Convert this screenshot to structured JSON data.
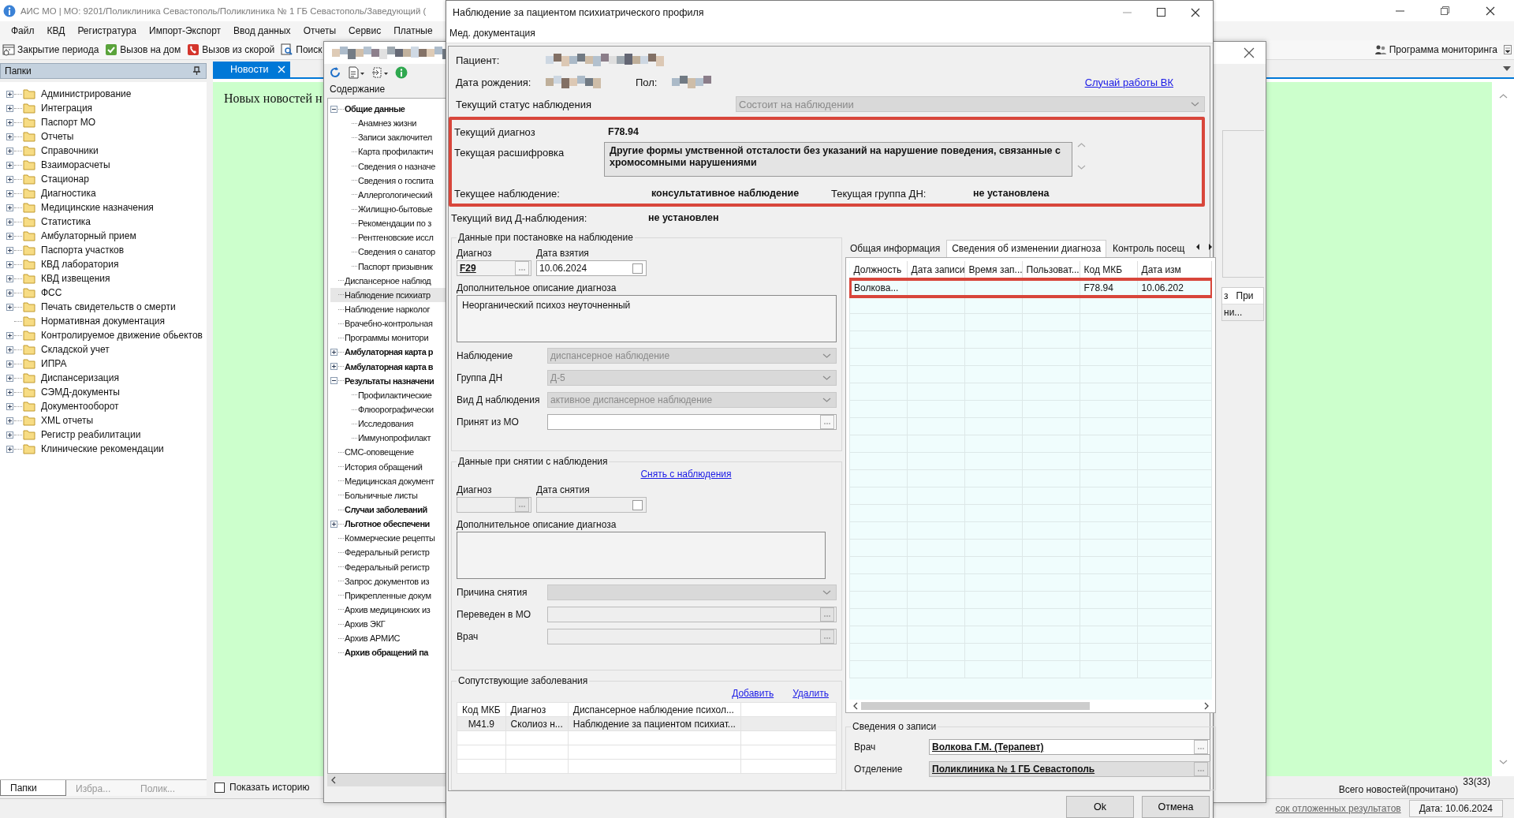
{
  "app": {
    "title": "АИС МО | МО: 9201/Поликлиника Севастополь/Поликлиника № 1 ГБ Севастополь/Заведующий (",
    "menu": [
      "Файл",
      "КВД",
      "Регистратура",
      "Импорт-Экспорт",
      "Ввод данных",
      "Отчеты",
      "Сервис",
      "Платные"
    ],
    "toolbar": [
      {
        "label": "Закрытие периода",
        "kind": "calendar"
      },
      {
        "label": "Вызов на дом",
        "kind": "check"
      },
      {
        "label": "Вызов из скорой",
        "kind": "phone"
      },
      {
        "label": "Поиск",
        "kind": "search"
      }
    ],
    "toolbar_right": [
      {
        "label": "Программа мониторинга",
        "kind": "people"
      }
    ],
    "folders": {
      "title": "Папки",
      "items": [
        {
          "label": "Администрирование",
          "has_children": true
        },
        {
          "label": "Интеграция",
          "has_children": true
        },
        {
          "label": "Паспорт МО",
          "has_children": true
        },
        {
          "label": "Отчеты",
          "has_children": true
        },
        {
          "label": "Справочники",
          "has_children": true
        },
        {
          "label": "Взаиморасчеты",
          "has_children": true
        },
        {
          "label": "Стационар",
          "has_children": true
        },
        {
          "label": "Диагностика",
          "has_children": true
        },
        {
          "label": "Медицинские назначения",
          "has_children": true
        },
        {
          "label": "Статистика",
          "has_children": true
        },
        {
          "label": "Амбулаторный прием",
          "has_children": true
        },
        {
          "label": "Паспорта участков",
          "has_children": true
        },
        {
          "label": "КВД лаборатория",
          "has_children": true
        },
        {
          "label": "КВД извещения",
          "has_children": true
        },
        {
          "label": "ФСС",
          "has_children": true
        },
        {
          "label": "Печать свидетельств о смерти",
          "has_children": true
        },
        {
          "label": "Нормативная документация",
          "has_children": false
        },
        {
          "label": "Контролируемое движение обьектов",
          "has_children": true
        },
        {
          "label": "Складской учет",
          "has_children": true
        },
        {
          "label": "ИПРА",
          "has_children": true
        },
        {
          "label": "Диспансеризация",
          "has_children": true
        },
        {
          "label": "СЭМД-документы",
          "has_children": true
        },
        {
          "label": "Документооборот",
          "has_children": true
        },
        {
          "label": "XML отчеты",
          "has_children": true
        },
        {
          "label": "Регистр реабилитации",
          "has_children": true
        },
        {
          "label": "Клинические рекомендации",
          "has_children": true
        }
      ],
      "tabs": [
        {
          "label": "Папки",
          "selected": true
        },
        {
          "label": "Избра...",
          "selected": false
        },
        {
          "label": "Полик...",
          "selected": false
        }
      ]
    },
    "news": {
      "tab": "Новости",
      "message": "Новых новостей н",
      "show_history": {
        "label": "Показать историю",
        "checked": false
      },
      "total_label": "Всего новостей(прочитано)",
      "total": "33(33)"
    },
    "status_bar": {
      "link": "сок отложенных результатов",
      "date": "Дата: 10.06.2024"
    }
  },
  "card_window": {
    "contents_title": "Содержание",
    "tree": [
      {
        "label": "Общие данные",
        "bold": true,
        "selected": false,
        "expanded": true,
        "children": [
          {
            "label": "Анамнез жизни",
            "selected": false
          },
          {
            "label": "Записи заключител",
            "selected": false
          },
          {
            "label": "Карта профилактич",
            "selected": false
          },
          {
            "label": "Сведения о назначе",
            "selected": false
          },
          {
            "label": "Сведения о госпита",
            "selected": false
          },
          {
            "label": "Аллергологический",
            "selected": false
          },
          {
            "label": "Жилищно-бытовые",
            "selected": false
          },
          {
            "label": "Рекомендации по з",
            "selected": false
          },
          {
            "label": "Рентгеновские иссл",
            "selected": false
          },
          {
            "label": "Сведения о санатор",
            "selected": false
          },
          {
            "label": "Паспорт призывник",
            "selected": false
          }
        ]
      },
      {
        "label": "Диспансерное наблюд",
        "bold": false,
        "selected": false
      },
      {
        "label": "Наблюдение психиатр",
        "bold": false,
        "selected": true
      },
      {
        "label": "Наблюдение нарколог",
        "bold": false,
        "selected": false
      },
      {
        "label": "Врачебно-контрольная",
        "bold": false,
        "selected": false
      },
      {
        "label": "Программы монитори",
        "bold": false,
        "selected": false
      },
      {
        "label": "Амбулаторная карта р",
        "bold": true,
        "selected": false,
        "expanded": false
      },
      {
        "label": "Амбулаторная карта в",
        "bold": true,
        "selected": false,
        "expanded": false
      },
      {
        "label": "Результаты назначени",
        "bold": true,
        "selected": false,
        "expanded": true,
        "children": [
          {
            "label": "Профилактические",
            "selected": false
          },
          {
            "label": "Флюорографически",
            "selected": false
          },
          {
            "label": "Исследования",
            "selected": false
          },
          {
            "label": "Иммунопрофилакт",
            "selected": false
          }
        ]
      },
      {
        "label": "СМС-оповещение",
        "bold": false,
        "selected": false
      },
      {
        "label": "История обращений",
        "bold": false,
        "selected": false
      },
      {
        "label": "Медицинская документ",
        "bold": false,
        "selected": false
      },
      {
        "label": "Больничные листы",
        "bold": false,
        "selected": false
      },
      {
        "label": "Случаи заболеваний",
        "bold": true,
        "selected": false
      },
      {
        "label": "Льготное обеспечени",
        "bold": true,
        "selected": false,
        "expanded": false
      },
      {
        "label": "Коммерческие рецепты",
        "bold": false,
        "selected": false
      },
      {
        "label": "Федеральный регистр",
        "bold": false,
        "selected": false
      },
      {
        "label": "Федеральный регистр",
        "bold": false,
        "selected": false
      },
      {
        "label": "Запрос документов из",
        "bold": false,
        "selected": false
      },
      {
        "label": "Прикрепленные докум",
        "bold": false,
        "selected": false
      },
      {
        "label": "Архив медицинских из",
        "bold": false,
        "selected": false
      },
      {
        "label": "Архив ЭКГ",
        "bold": false,
        "selected": false
      },
      {
        "label": "Архив АРМИС",
        "bold": false,
        "selected": false
      },
      {
        "label": "Архив обращений па",
        "bold": true,
        "selected": false
      }
    ],
    "grid_columns": [
      "з",
      "При"
    ],
    "grid_cells": [
      "ни..."
    ]
  },
  "dialog": {
    "title": "Наблюдение за пациентом психиатрического профиля",
    "menu": [
      "Мед. документация"
    ],
    "patient": {
      "patient_label": "Пациент:",
      "birth_label": "Дата рождения:",
      "sex_label": "Пол:",
      "vk_link": "Случай работы ВК",
      "status_label": "Текущий статус наблюдения",
      "status": {
        "value": "Состоит на наблюдении",
        "disabled": true
      }
    },
    "current": {
      "highlight": true,
      "diagnosis_label": "Текущий диагноз",
      "diagnosis": "F78.94",
      "decoding_label": "Текущая расшифровка",
      "decoding": "Другие формы умственной отсталости без указаний на нарушение поведения, связанные с хромосомными нарушениями",
      "observation_label": "Текущее наблюдение:",
      "observation": "консультативное наблюдение",
      "group_label": "Текущая группа ДН:",
      "group": "не установлена"
    },
    "d_type_label": "Текущий вид Д-наблюдения:",
    "d_type": "не установлен",
    "registration": {
      "title": "Данные при постановке на наблюдение",
      "diagnosis_label": "Диагноз",
      "diagnosis": "F29",
      "date_label": "Дата взятия",
      "date": "10.06.2024",
      "description_label": "Дополнительное описание диагноза",
      "description": "Неорганический психоз неуточненный",
      "fields": [
        {
          "label": "Наблюдение",
          "value": "диспансерное наблюдение",
          "kind": "dropdown",
          "disabled": true
        },
        {
          "label": "Группа ДН",
          "value": "Д-5",
          "kind": "dropdown",
          "disabled": true
        },
        {
          "label": "Вид Д наблюдения",
          "value": "активное диспансерное наблюдение",
          "kind": "dropdown",
          "disabled": true
        },
        {
          "label": "Принят из МО",
          "kind": "lookup",
          "disabled": false
        }
      ]
    },
    "removal": {
      "title": "Данные при снятии с наблюдения",
      "link": "Снять с наблюдения",
      "diagnosis_label": "Диагноз",
      "date_label": "Дата снятия",
      "description_label": "Дополнительное описание диагноза",
      "fields": [
        {
          "label": "Причина снятия",
          "kind": "dropdown",
          "disabled": true
        },
        {
          "label": "Переведен в МО",
          "kind": "lookup",
          "disabled": true
        },
        {
          "label": "Врач",
          "kind": "lookup",
          "disabled": true
        }
      ]
    },
    "concomitant": {
      "title": "Сопутствующие заболевания",
      "actions": [
        "Добавить",
        "Удалить"
      ],
      "columns": [
        "Код МКБ",
        "Диагноз",
        "Диспансерное наблюдение психол..."
      ],
      "rows": [
        {
          "cells": [
            "M41.9",
            "Сколиоз н...",
            "Наблюдение за пациентом психиат..."
          ],
          "selected": true
        }
      ]
    },
    "tabs": [
      {
        "label": "Общая информация",
        "selected": false
      },
      {
        "label": "Сведения об изменении диагноза",
        "selected": true
      },
      {
        "label": "Контроль посещ",
        "selected": false
      }
    ],
    "history": {
      "columns": [
        "Должность",
        "Дата записи",
        "Время зап...",
        "Пользоват...",
        "Код МКБ",
        "Дата изм"
      ],
      "rows": [
        {
          "cells": [
            "Волкова...",
            null,
            null,
            null,
            "F78.94",
            "10.06.202"
          ],
          "highlight": true
        }
      ]
    },
    "record": {
      "title": "Сведения о записи",
      "doctor_label": "Врач",
      "doctor": "Волкова Г.М. (Терапевт)",
      "department_label": "Отделение",
      "department": "Поликлиника № 1 ГБ Севастополь"
    },
    "buttons": [
      "Ok",
      "Отмена"
    ]
  }
}
